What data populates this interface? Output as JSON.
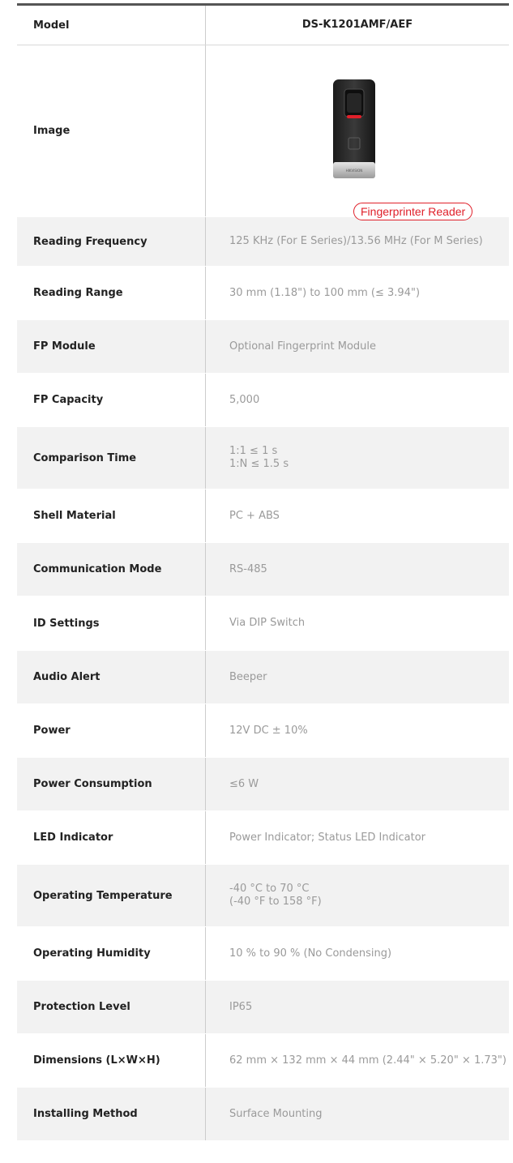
{
  "header": {
    "label": "Model",
    "value": "DS-K1201AMF/AEF"
  },
  "image_row": {
    "label": "Image",
    "caption": "Fingerprinter Reader",
    "device_icon": "fingerprint-reader-icon",
    "device_brand": "HIKVISION"
  },
  "specs": [
    {
      "label": "Reading Frequency",
      "lines": [
        "125 KHz (For E Series)/13.56 MHz (For M Series)"
      ]
    },
    {
      "label": "Reading Range",
      "lines": [
        "30 mm (1.18\") to 100 mm (≤ 3.94\")"
      ]
    },
    {
      "label": "FP Module",
      "lines": [
        "Optional Fingerprint Module"
      ]
    },
    {
      "label": "FP Capacity",
      "lines": [
        "5,000"
      ]
    },
    {
      "label": "Comparison Time",
      "lines": [
        "1:1 ≤ 1 s",
        "1:N ≤ 1.5 s"
      ]
    },
    {
      "label": "Shell Material",
      "lines": [
        "PC + ABS"
      ]
    },
    {
      "label": "Communication Mode",
      "lines": [
        "RS-485"
      ]
    },
    {
      "label": "ID Settings",
      "lines": [
        "Via DIP Switch"
      ]
    },
    {
      "label": "Audio Alert",
      "lines": [
        "Beeper"
      ]
    },
    {
      "label": "Power",
      "lines": [
        "12V DC ± 10%"
      ]
    },
    {
      "label": "Power Consumption",
      "lines": [
        "≤6 W"
      ]
    },
    {
      "label": "LED Indicator",
      "lines": [
        "Power Indicator; Status LED Indicator"
      ]
    },
    {
      "label": "Operating Temperature",
      "lines": [
        "-40 °C to 70 °C",
        "(-40 °F to 158 °F)"
      ]
    },
    {
      "label": "Operating Humidity",
      "lines": [
        "10 % to 90 % (No Condensing)"
      ]
    },
    {
      "label": "Protection Level",
      "lines": [
        "IP65"
      ]
    },
    {
      "label": "Dimensions (L×W×H)",
      "lines": [
        "62 mm × 132 mm × 44 mm (2.44\" × 5.20\" × 1.73\")"
      ]
    },
    {
      "label": "Installing Method",
      "lines": [
        "Surface Mounting"
      ]
    }
  ]
}
